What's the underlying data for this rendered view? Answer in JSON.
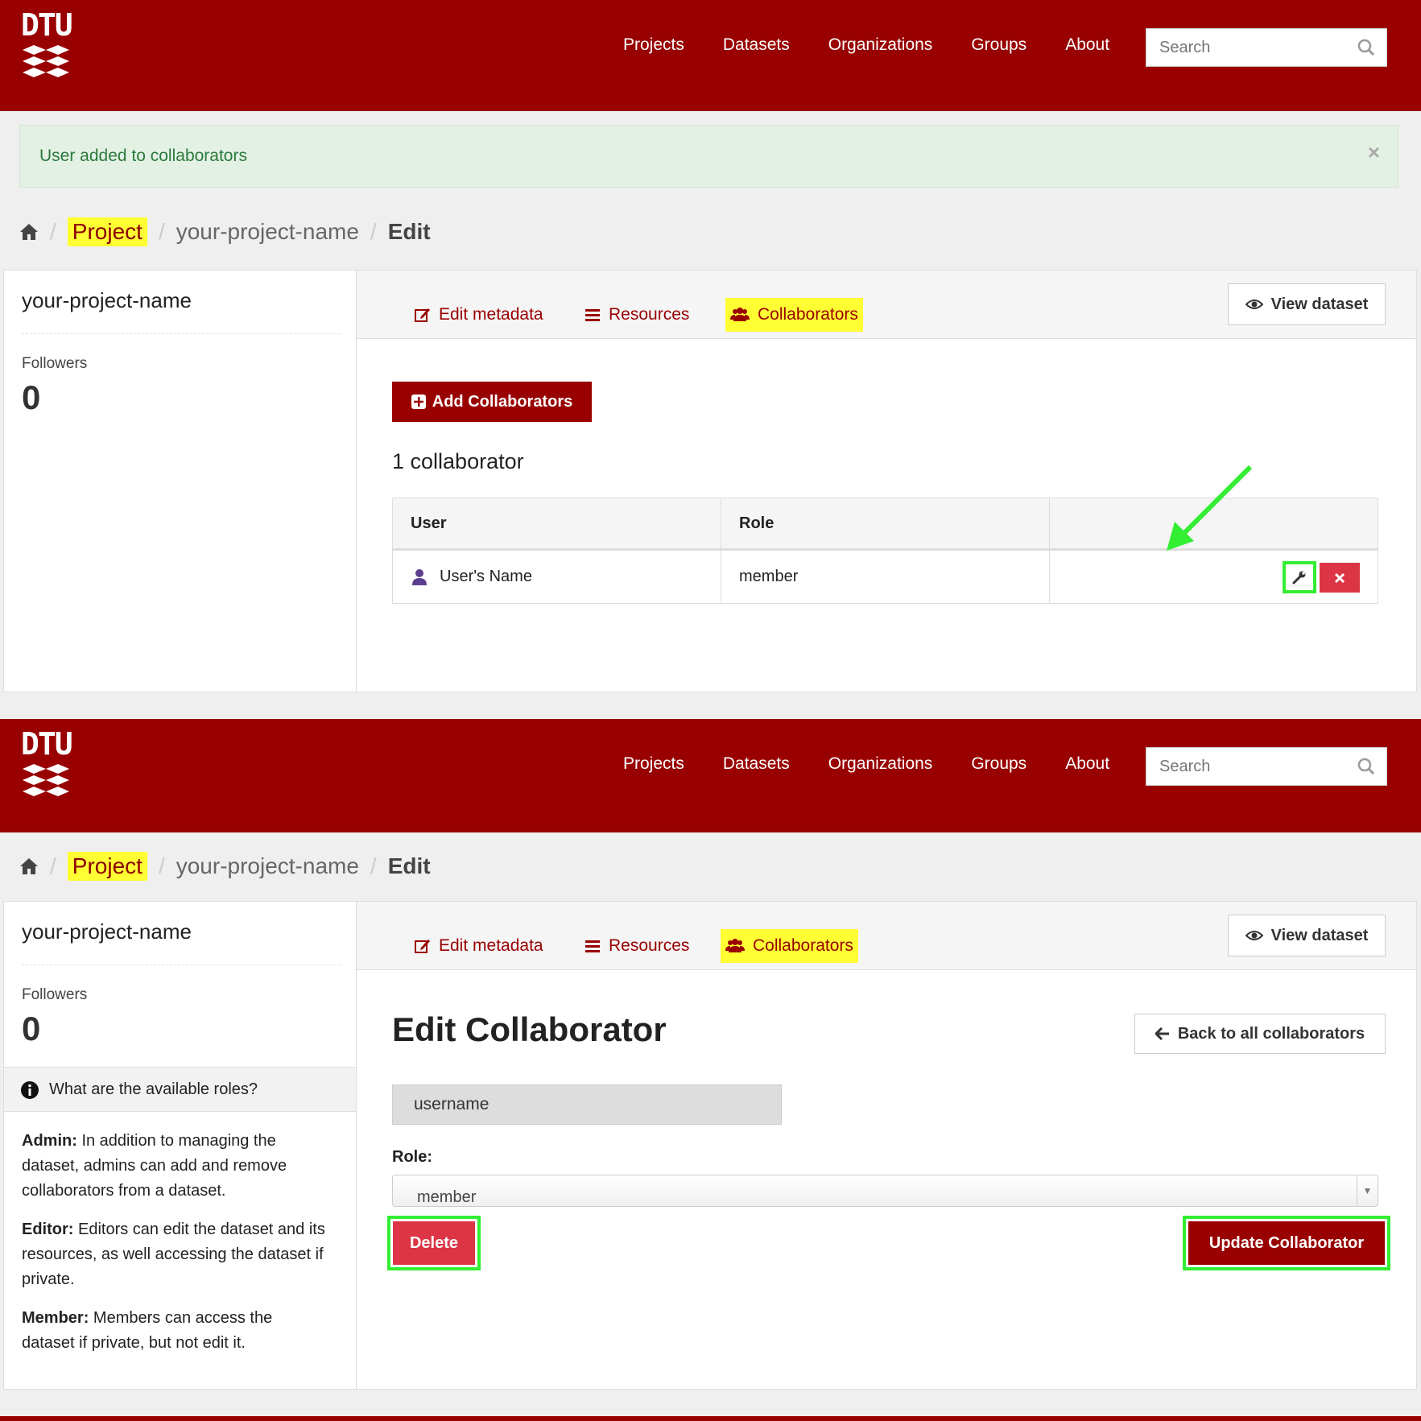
{
  "colors": {
    "brand": "#990000",
    "highlight": "#ffff33",
    "annotation": "#33ee33",
    "danger": "#dc3545"
  },
  "logo": {
    "text": "DTU"
  },
  "nav": {
    "items": [
      "Projects",
      "Datasets",
      "Organizations",
      "Groups",
      "About"
    ]
  },
  "search": {
    "placeholder": "Search"
  },
  "breadcrumb": {
    "home_icon": "home-icon",
    "project": "Project",
    "name": "your-project-name",
    "edit": "Edit"
  },
  "sidebar": {
    "title": "your-project-name",
    "followers_label": "Followers",
    "followers_count": "0",
    "roles_heading": "What are the available roles?",
    "roles": [
      {
        "name": "Admin:",
        "desc": " In addition to managing the dataset, admins can add and remove collaborators from a dataset."
      },
      {
        "name": "Editor:",
        "desc": " Editors can edit the dataset and its resources, as well accessing the dataset if private."
      },
      {
        "name": "Member:",
        "desc": " Members can access the dataset if private, but not edit it."
      }
    ]
  },
  "tabs": {
    "edit_metadata": "Edit metadata",
    "resources": "Resources",
    "collaborators": "Collaborators"
  },
  "view_dataset": "View dataset",
  "screen1": {
    "alert": "User added to collaborators",
    "alert_close": "×",
    "add_button": "Add Collaborators",
    "count_text": "1 collaborator",
    "table": {
      "headers": [
        "User",
        "Role",
        ""
      ],
      "rows": [
        {
          "user": "User's Name",
          "role": "member"
        }
      ]
    }
  },
  "screen2": {
    "title": "Edit Collaborator",
    "back_button": "Back to all collaborators",
    "username": "username",
    "role_label": "Role:",
    "role_value": "member",
    "delete_button": "Delete",
    "update_button": "Update Collaborator"
  }
}
